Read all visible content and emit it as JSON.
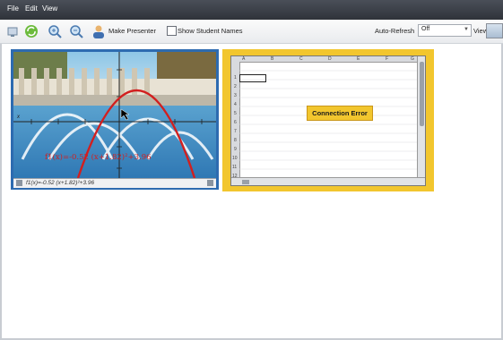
{
  "menu": {
    "items": [
      "File",
      "Edit",
      "View"
    ]
  },
  "toolbar": {
    "make_presenter_label": "Make Presenter",
    "show_student_names_label": "Show Student Names",
    "auto_refresh_label": "Auto-Refresh",
    "auto_refresh_value": "Off",
    "view_label": "View"
  },
  "thumb1": {
    "formula_graph": "f1(x)=-0.52 (x+1.82)²+3.96",
    "formula_entry": "f1(x)=-0.52 (x+1.82)²+3.96",
    "axis_x_label": "x"
  },
  "thumb2": {
    "status": "Connection Error",
    "columns": [
      "A",
      "B",
      "C",
      "D",
      "E",
      "F",
      "G"
    ],
    "rows": [
      "1",
      "2",
      "3",
      "4",
      "5",
      "6",
      "7",
      "8",
      "9",
      "10",
      "11",
      "12"
    ]
  }
}
